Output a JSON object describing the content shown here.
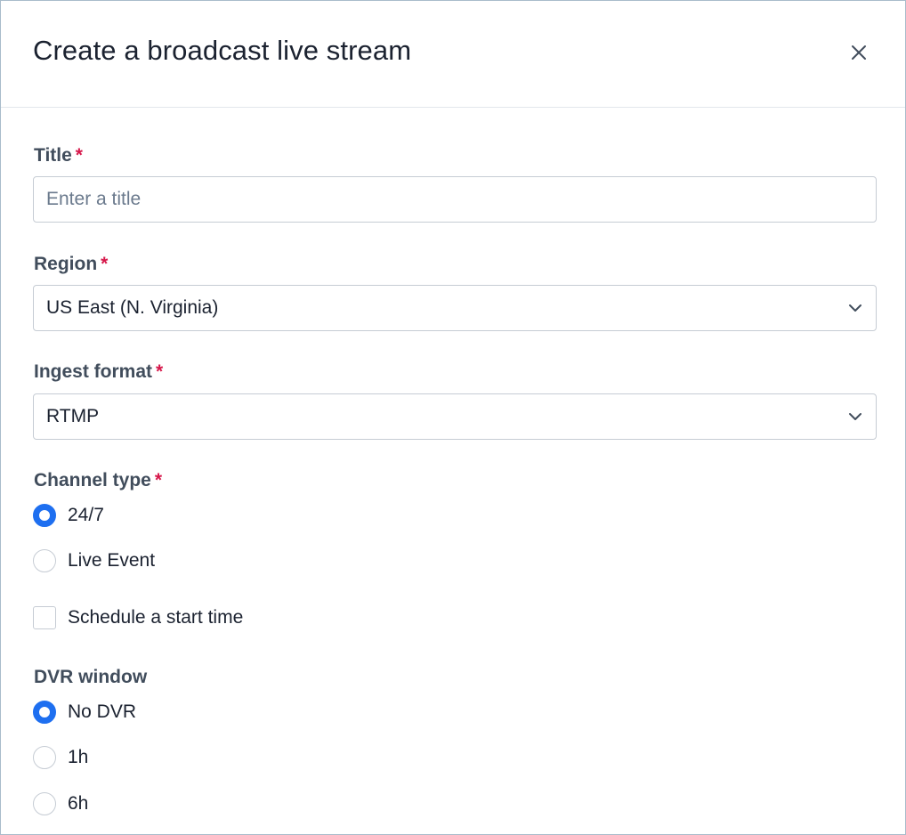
{
  "dialog": {
    "title": "Create a broadcast live stream",
    "close_icon": "close-icon"
  },
  "fields": {
    "title": {
      "label": "Title",
      "required_mark": "*",
      "value": "",
      "placeholder": "Enter a title"
    },
    "region": {
      "label": "Region",
      "required_mark": "*",
      "selected": "US East (N. Virginia)",
      "icon": "chevron-down-icon"
    },
    "ingest_format": {
      "label": "Ingest format",
      "required_mark": "*",
      "selected": "RTMP",
      "icon": "chevron-down-icon"
    },
    "channel_type": {
      "label": "Channel type",
      "required_mark": "*",
      "options": [
        {
          "label": "24/7",
          "selected": true
        },
        {
          "label": "Live Event",
          "selected": false
        }
      ]
    },
    "schedule": {
      "label": "Schedule a start time",
      "checked": false
    },
    "dvr_window": {
      "label": "DVR window",
      "options": [
        {
          "label": "No DVR",
          "selected": true
        },
        {
          "label": "1h",
          "selected": false
        },
        {
          "label": "6h",
          "selected": false
        }
      ]
    }
  },
  "colors": {
    "accent": "#1e6ff0",
    "required": "#d6174a",
    "label": "#414d5c",
    "border": "#c6ccd4"
  }
}
